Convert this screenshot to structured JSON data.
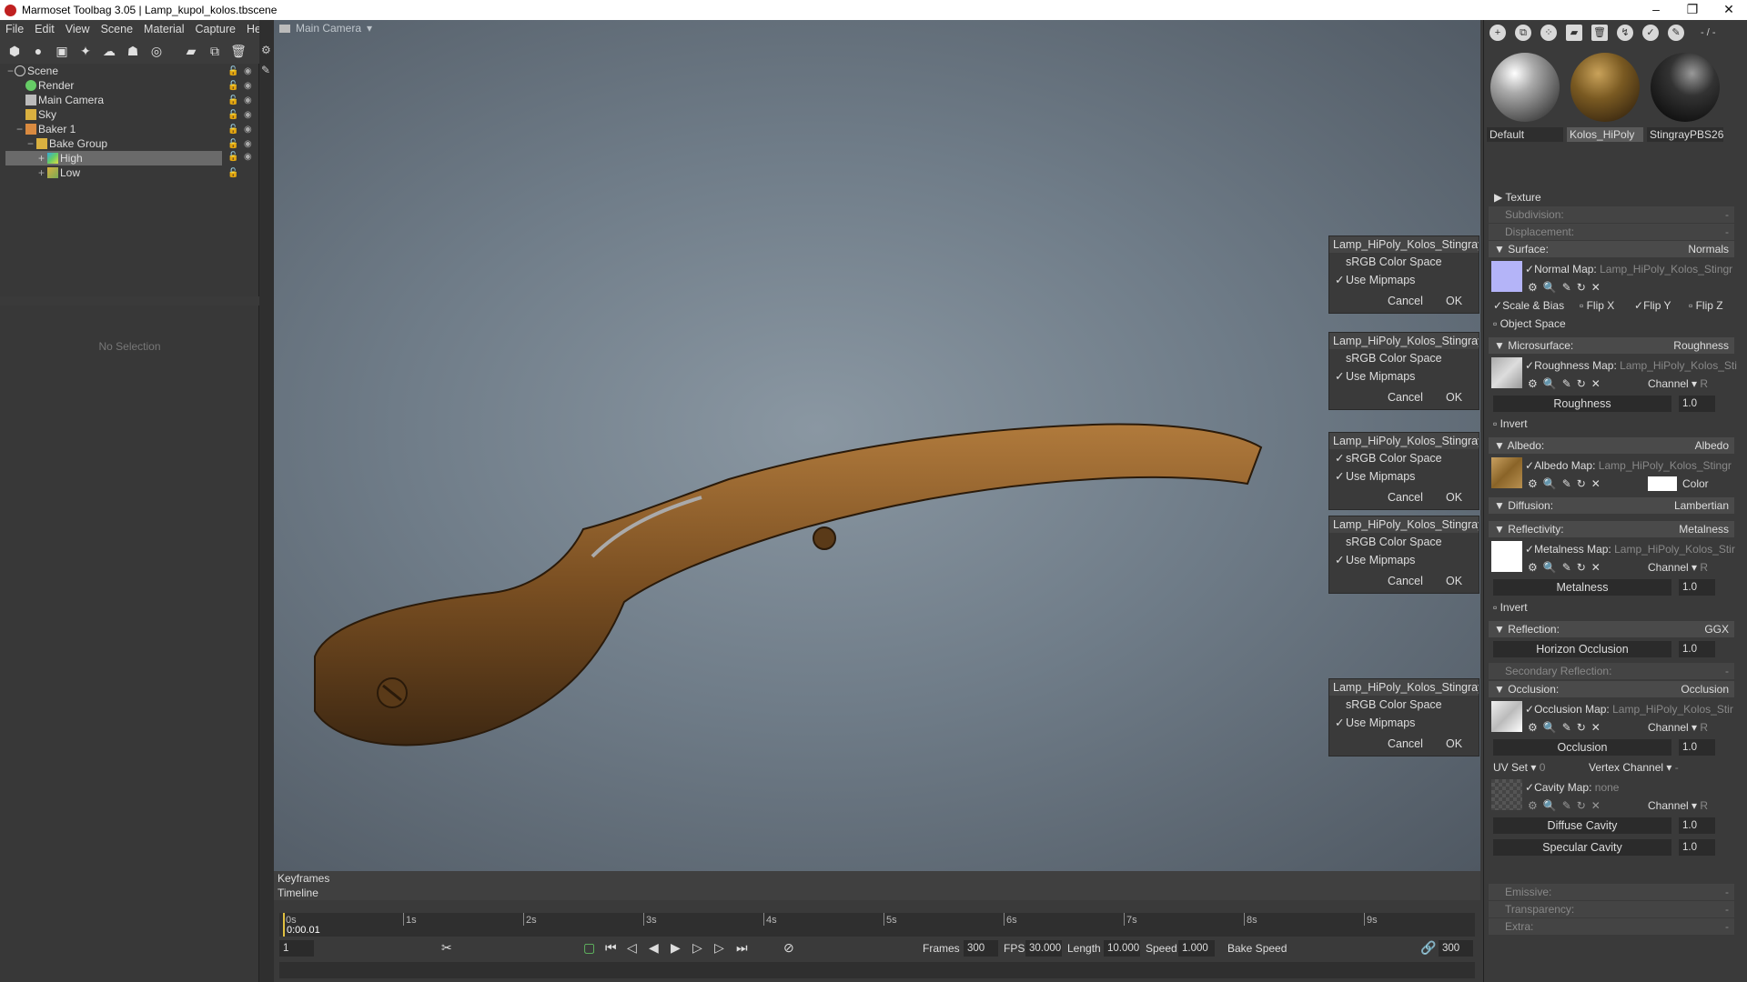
{
  "window": {
    "title": "Marmoset Toolbag 3.05  |  Lamp_kupol_kolos.tbscene",
    "minimize": "–",
    "maximize": "❐",
    "close": "✕"
  },
  "menu": [
    "File",
    "Edit",
    "View",
    "Scene",
    "Material",
    "Capture",
    "Help"
  ],
  "outliner": {
    "items": [
      {
        "label": "Scene",
        "icon": "scene-icon"
      },
      {
        "label": "Render",
        "icon": "render-icon"
      },
      {
        "label": "Main Camera",
        "icon": "camera-icon"
      },
      {
        "label": "Sky",
        "icon": "sky-icon"
      },
      {
        "label": "Baker 1",
        "icon": "baker-icon"
      },
      {
        "label": "Bake Group",
        "icon": "folder-icon"
      },
      {
        "label": "High",
        "icon": "mesh-high-icon"
      },
      {
        "label": "Low",
        "icon": "mesh-low-icon"
      }
    ],
    "no_selection": "No Selection"
  },
  "viewport": {
    "camera": "Main Camera",
    "camera_arrow": "▾"
  },
  "texture_dialogs": [
    {
      "title": "Lamp_HiPoly_Kolos_StingrayPBS",
      "srgb_label": "sRGB Color Space",
      "srgb": false,
      "mip_label": "Use Mipmaps",
      "mip": true,
      "cancel": "Cancel",
      "ok": "OK"
    },
    {
      "title": "Lamp_HiPoly_Kolos_StingrayPBS",
      "srgb_label": "sRGB Color Space",
      "srgb": false,
      "mip_label": "Use Mipmaps",
      "mip": true,
      "cancel": "Cancel",
      "ok": "OK"
    },
    {
      "title": "Lamp_HiPoly_Kolos_StingrayPBS",
      "srgb_label": "sRGB Color Space",
      "srgb": true,
      "mip_label": "Use Mipmaps",
      "mip": true,
      "cancel": "Cancel",
      "ok": "OK"
    },
    {
      "title": "Lamp_HiPoly_Kolos_StingrayPBS",
      "srgb_label": "sRGB Color Space",
      "srgb": false,
      "mip_label": "Use Mipmaps",
      "mip": true,
      "cancel": "Cancel",
      "ok": "OK"
    },
    {
      "title": "Lamp_HiPoly_Kolos_StingrayPBS",
      "srgb_label": "sRGB Color Space",
      "srgb": false,
      "mip_label": "Use Mipmaps",
      "mip": true,
      "cancel": "Cancel",
      "ok": "OK"
    }
  ],
  "materials": {
    "top_value": "- / -",
    "items": [
      {
        "label": "Default",
        "color": "#9a9a9a"
      },
      {
        "label": "Kolos_HiPoly",
        "color": "#6b5020"
      },
      {
        "label": "StingrayPBS26",
        "color": "#1a1a1a"
      }
    ]
  },
  "material_editor": {
    "texture": "Texture",
    "subdivision": "Subdivision:",
    "subdivision_val": "-",
    "displacement": "Displacement:",
    "displacement_val": "-",
    "surface": "Surface:",
    "surface_val": "Normals",
    "normal_map_label": "Normal Map:",
    "normal_map_file": "Lamp_HiPoly_Kolos_Stingr",
    "scale_bias": "Scale & Bias",
    "flip_x": "Flip X",
    "flip_y": "Flip Y",
    "flip_z": "Flip Z",
    "object_space": "Object Space",
    "microsurface": "Microsurface:",
    "microsurface_val": "Roughness",
    "roughness_map_label": "Roughness Map:",
    "roughness_map_file": "Lamp_HiPoly_Kolos_Sti",
    "channel": "Channel",
    "channel_r": "R",
    "roughness": "Roughness",
    "roughness_val": "1.0",
    "invert": "Invert",
    "albedo": "Albedo:",
    "albedo_val": "Albedo",
    "albedo_map_label": "Albedo Map:",
    "albedo_map_file": "Lamp_HiPoly_Kolos_Stingr",
    "color": "Color",
    "diffusion": "Diffusion:",
    "diffusion_val": "Lambertian",
    "reflectivity": "Reflectivity:",
    "reflectivity_val": "Metalness",
    "metalness_map_label": "Metalness Map:",
    "metalness_map_file": "Lamp_HiPoly_Kolos_Stir",
    "metalness": "Metalness",
    "metalness_val": "1.0",
    "reflection": "Reflection:",
    "reflection_val": "GGX",
    "horizon_occlusion": "Horizon Occlusion",
    "horizon_val": "1.0",
    "secondary_reflection": "Secondary Reflection:",
    "secondary_val": "-",
    "occlusion": "Occlusion:",
    "occlusion_val": "Occlusion",
    "occlusion_map_label": "Occlusion Map:",
    "occlusion_map_file": "Lamp_HiPoly_Kolos_Stir",
    "occlusion_slider": "Occlusion",
    "occlusion_num": "1.0",
    "uv_set": "UV Set",
    "uv_set_val": "0",
    "vertex_channel": "Vertex Channel",
    "vertex_val": "-",
    "cavity_map_label": "Cavity Map:",
    "cavity_map_file": "none",
    "diffuse_cavity": "Diffuse Cavity",
    "diffuse_cavity_val": "1.0",
    "specular_cavity": "Specular Cavity",
    "specular_cavity_val": "1.0",
    "emissive": "Emissive:",
    "emissive_val": "-",
    "transparency": "Transparency:",
    "transparency_val": "-",
    "extra": "Extra:",
    "extra_val": "-"
  },
  "timeline": {
    "keyframes": "Keyframes",
    "timeline": "Timeline",
    "ticks": [
      "0s",
      "1s",
      "2s",
      "3s",
      "4s",
      "5s",
      "6s",
      "7s",
      "8s",
      "9s"
    ],
    "current_time": "0:00.01",
    "frame": "1",
    "frames_label": "Frames",
    "frames_val": "300",
    "fps_label": "FPS",
    "fps_val": "30.000",
    "length_label": "Length",
    "length_val": "10.000",
    "speed_label": "Speed",
    "speed_val": "1.000",
    "bake_speed": "Bake Speed",
    "end_frame": "300"
  }
}
